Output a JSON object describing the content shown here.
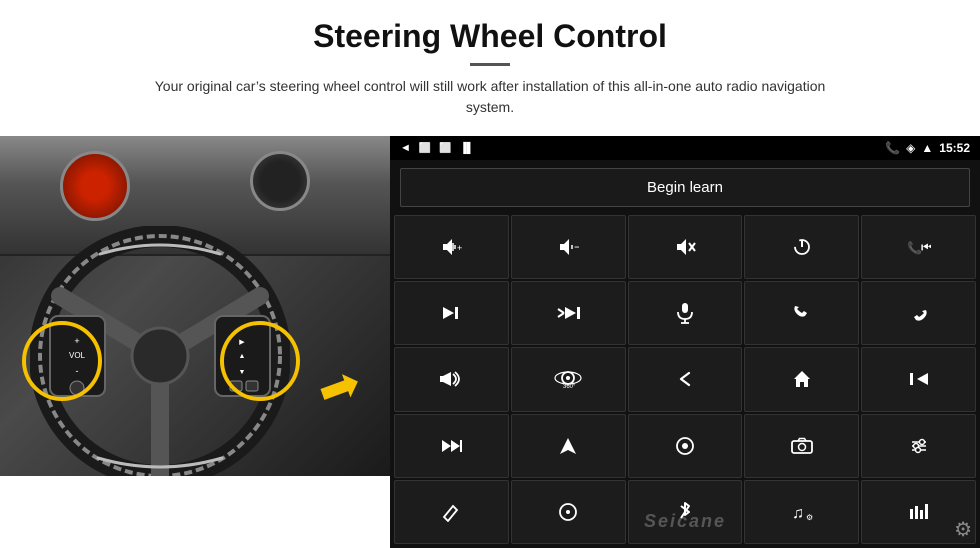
{
  "header": {
    "title": "Steering Wheel Control",
    "subtitle": "Your original car’s steering wheel control will still work after installation of this all-in-one auto radio navigation system."
  },
  "status_bar": {
    "nav_back": "◄",
    "nav_home": "□",
    "nav_recent": "□",
    "signal_icon": "✈",
    "time": "15:52",
    "phone_icon": "☎",
    "location_icon": "▲",
    "wifi_icon": "▲"
  },
  "begin_learn_label": "Begin learn",
  "controls": [
    {
      "icon": "🔊+",
      "label": "vol-up"
    },
    {
      "icon": "🔈−",
      "label": "vol-down"
    },
    {
      "icon": "🔇",
      "label": "mute"
    },
    {
      "icon": "⏻",
      "label": "power"
    },
    {
      "icon": "☎⏮",
      "label": "phone-prev"
    },
    {
      "icon": "⏭",
      "label": "next-track"
    },
    {
      "icon": "✘⏭",
      "label": "skip"
    },
    {
      "icon": "🎤",
      "label": "mic"
    },
    {
      "icon": "☎",
      "label": "phone"
    },
    {
      "icon": "⤵",
      "label": "hang-up"
    },
    {
      "icon": "📢",
      "label": "announce"
    },
    {
      "icon": "🔀",
      "label": "360"
    },
    {
      "icon": "↩",
      "label": "back"
    },
    {
      "icon": "⌂",
      "label": "home"
    },
    {
      "icon": "⏮⏮",
      "label": "prev-track"
    },
    {
      "icon": "⏭⏭",
      "label": "fast-forward"
    },
    {
      "icon": "▶",
      "label": "play-nav"
    },
    {
      "icon": "⦿",
      "label": "source"
    },
    {
      "icon": "📷",
      "label": "camera"
    },
    {
      "icon": "⥎",
      "label": "settings-eq"
    },
    {
      "icon": "✏",
      "label": "pen"
    },
    {
      "icon": "◎",
      "label": "circle-btn"
    },
    {
      "icon": "★",
      "label": "bluetooth"
    },
    {
      "icon": "♫",
      "label": "music"
    },
    {
      "icon": "⌶",
      "label": "equalizer"
    }
  ],
  "watermark": "Seicane",
  "gear_icon": "⚙"
}
